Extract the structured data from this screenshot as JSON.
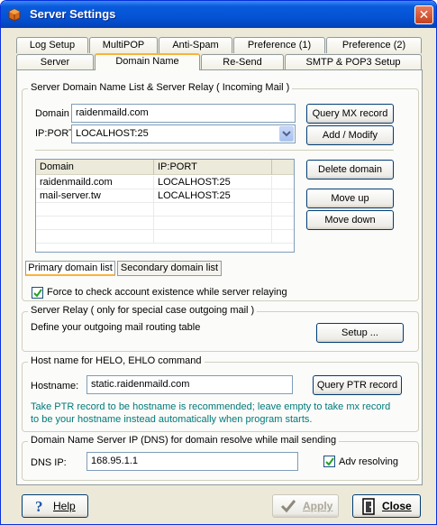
{
  "window": {
    "title": "Server Settings",
    "close_glyph": "✕"
  },
  "tabs_row1": [
    "Log Setup",
    "MultiPOP",
    "Anti-Spam",
    "Preference (1)",
    "Preference (2)"
  ],
  "tabs_row2": [
    "Server",
    "Domain Name",
    "Re-Send",
    "SMTP & POP3 Setup"
  ],
  "active_tab": "Domain Name",
  "domain_group": {
    "legend": "Server Domain Name List & Server Relay ( Incoming Mail )",
    "domain_label": "Domain",
    "domain_value": "raidenmaild.com",
    "ipport_label": "IP:PORT",
    "ipport_value": "LOCALHOST:25",
    "query_mx_button": "Query MX record",
    "add_modify_button": "Add / Modify",
    "delete_button": "Delete domain",
    "move_up_button": "Move up",
    "move_down_button": "Move down",
    "table": {
      "columns": [
        "Domain",
        "IP:PORT"
      ],
      "rows": [
        {
          "domain": "raidenmaild.com",
          "ipport": "LOCALHOST:25"
        },
        {
          "domain": "mail-server.tw",
          "ipport": "LOCALHOST:25"
        }
      ]
    },
    "subtabs": [
      "Primary domain list",
      "Secondary domain list"
    ],
    "force_check_label": "Force to check account existence while server relaying",
    "force_check_checked": true
  },
  "relay_group": {
    "legend": "Server Relay ( only for special case outgoing mail )",
    "description": "Define your outgoing mail routing table",
    "setup_button": "Setup ..."
  },
  "helo_group": {
    "legend": "Host name for HELO, EHLO command",
    "hostname_label": "Hostname:",
    "hostname_value": "static.raidenmaild.com",
    "query_ptr_button": "Query PTR record",
    "note_line1": "Take PTR record to be hostname is recommended; leave empty to take mx record",
    "note_line2": "to be your hostname instead automatically when program starts."
  },
  "dns_group": {
    "legend": "Domain Name Server IP (DNS) for domain resolve while mail sending",
    "dns_label": "DNS IP:",
    "dns_value": "168.95.1.1",
    "adv_label": "Adv resolving",
    "adv_checked": true
  },
  "footer": {
    "help_button": "Help",
    "apply_button": "Apply",
    "close_button": "Close"
  },
  "icons": [
    "app-icon",
    "help-icon",
    "apply-check-icon",
    "close-door-icon",
    "chevron-down-icon"
  ]
}
